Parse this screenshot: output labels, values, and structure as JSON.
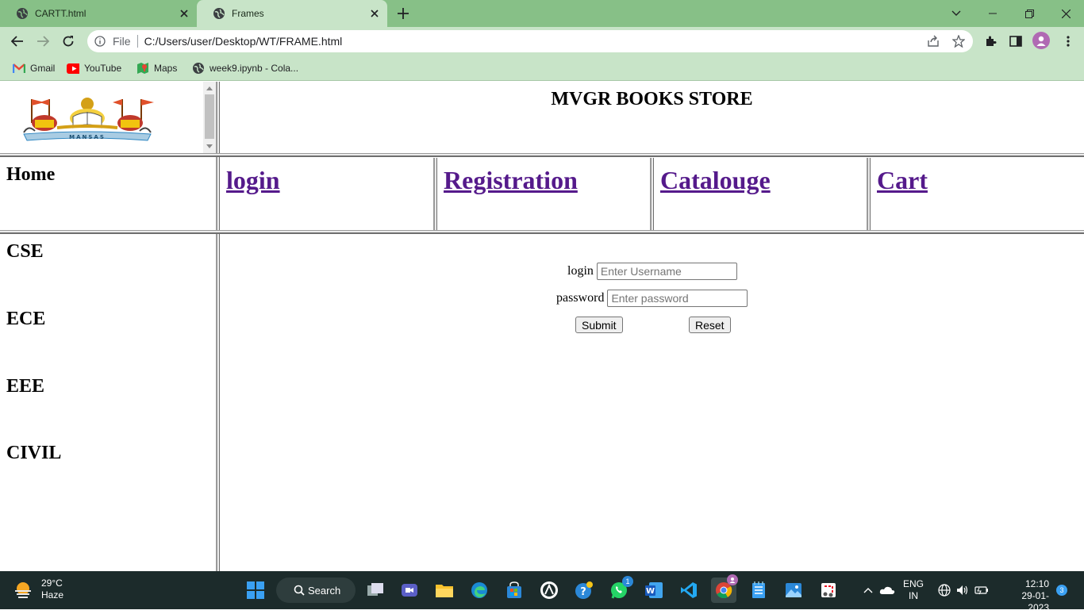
{
  "browser": {
    "tabs": [
      {
        "title": "CARTT.html",
        "active": false
      },
      {
        "title": "Frames",
        "active": true
      }
    ],
    "address": {
      "scheme_label": "File",
      "url": "C:/Users/user/Desktop/WT/FRAME.html"
    },
    "bookmarks": [
      {
        "label": "Gmail",
        "icon": "gmail-icon"
      },
      {
        "label": "YouTube",
        "icon": "youtube-icon"
      },
      {
        "label": "Maps",
        "icon": "maps-icon"
      },
      {
        "label": "week9.ipynb - Cola...",
        "icon": "globe-icon"
      }
    ],
    "colors": {
      "chrome": "#87c087",
      "toolbar": "#c8e4c8"
    }
  },
  "page": {
    "store_title": "MVGR BOOKS STORE",
    "logo_text": "MANSAS",
    "home_label": "Home",
    "nav_links": [
      "login",
      "Registration",
      "Catalouge",
      "Cart"
    ],
    "branches": [
      "CSE",
      "ECE",
      "EEE",
      "CIVIL"
    ],
    "login_form": {
      "login_label": "login",
      "username_placeholder": "Enter Username",
      "password_label": "password",
      "password_placeholder": "Enter password",
      "submit_label": "Submit",
      "reset_label": "Reset"
    },
    "link_color": "#551a8b"
  },
  "taskbar": {
    "weather": {
      "temp": "29°C",
      "condition": "Haze"
    },
    "search_label": "Search",
    "whatsapp_badge": "1",
    "language": {
      "line1": "ENG",
      "line2": "IN"
    },
    "clock": {
      "time": "12:10",
      "date": "29-01-2023"
    },
    "notification_count": "3"
  }
}
